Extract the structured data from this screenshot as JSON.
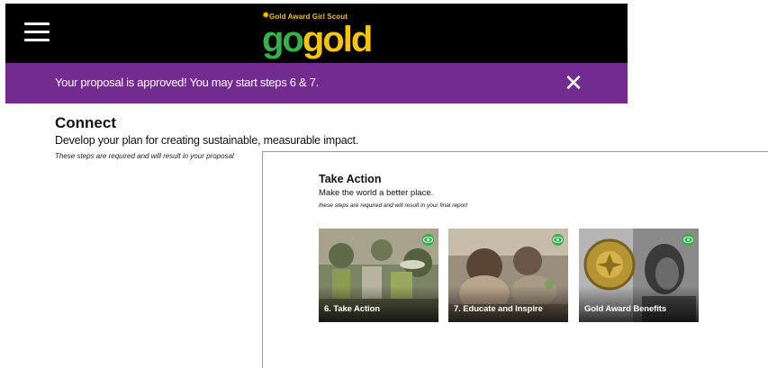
{
  "header": {
    "menu_icon": "hamburger-menu-icon",
    "logo": {
      "tagline": "Gold Award Girl Scout",
      "word_go": "go",
      "word_gold": "gold",
      "colors": {
        "go": "#35b24a",
        "gold": "#f6c40d",
        "tagline": "#f2c200"
      }
    },
    "background": "#000000"
  },
  "banner": {
    "text": "Your proposal is approved!  You may start steps 6 & 7.",
    "close_icon": "close-icon",
    "background": "#722b8f"
  },
  "connect": {
    "title": "Connect",
    "subtitle": "Develop your plan for creating sustainable, measurable impact.",
    "note": "These steps are required and will result in your proposal"
  },
  "take_action": {
    "title": "Take Action",
    "subtitle": "Make the world a better place.",
    "note": "these steps are required and will result in your final report",
    "cards": [
      {
        "label": "6. Take Action",
        "icon": "eye-icon"
      },
      {
        "label": "7. Educate and Inspire",
        "icon": "eye-icon"
      },
      {
        "label": "Gold Award Benefits",
        "icon": "eye-icon"
      }
    ]
  }
}
